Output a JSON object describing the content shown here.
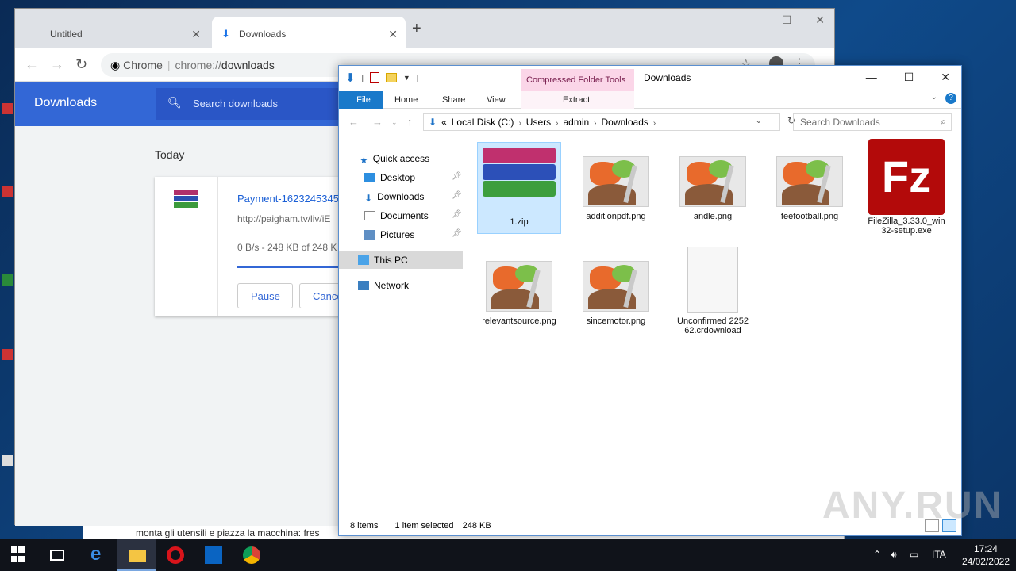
{
  "chrome": {
    "tabs": [
      {
        "label": "Untitled"
      },
      {
        "label": "Downloads"
      }
    ],
    "omnibox": {
      "security": "Chrome",
      "url_prefix": "chrome://",
      "url_path": "downloads"
    },
    "downloads_page": {
      "title": "Downloads",
      "search_placeholder": "Search downloads",
      "date_group": "Today",
      "item": {
        "filename": "Payment-1623245345-",
        "url": "http://paigham.tv/liv/iE",
        "status": "0 B/s - 248 KB of 248 K",
        "progress": 1.0,
        "pause_label": "Pause",
        "cancel_label": "Cance"
      }
    }
  },
  "explorer": {
    "contextual_tab": "Compressed Folder Tools",
    "window_title": "Downloads",
    "ribbon_tabs": {
      "file": "File",
      "home": "Home",
      "share": "Share",
      "view": "View",
      "extract": "Extract"
    },
    "address": {
      "overflow": "«",
      "crumbs": [
        "Local Disk (C:)",
        "Users",
        "admin",
        "Downloads"
      ]
    },
    "search_placeholder": "Search Downloads",
    "nav": {
      "quick_access": "Quick access",
      "desktop": "Desktop",
      "downloads": "Downloads",
      "documents": "Documents",
      "pictures": "Pictures",
      "this_pc": "This PC",
      "network": "Network"
    },
    "files": [
      {
        "name": "1.zip",
        "icon": "winrar-archive-icon"
      },
      {
        "name": "additionpdf.png",
        "icon": "paint-image-icon"
      },
      {
        "name": "andle.png",
        "icon": "paint-image-icon"
      },
      {
        "name": "feefootball.png",
        "icon": "paint-image-icon"
      },
      {
        "name": "FileZilla_3.33.0_win32-setup.exe",
        "icon": "filezilla-icon"
      },
      {
        "name": "relevantsource.png",
        "icon": "paint-image-icon"
      },
      {
        "name": "sincemotor.png",
        "icon": "paint-image-icon"
      },
      {
        "name": "Unconfirmed 225262.crdownload",
        "icon": "blank-file-icon"
      }
    ],
    "status": {
      "count": "8 items",
      "selection": "1 item selected",
      "size": "248 KB"
    }
  },
  "background_doc": {
    "text": "monta gli utensili e piazza la macchina: fres"
  },
  "watermark": "ANY.RUN",
  "taskbar": {
    "language": "ITA",
    "time": "17:24",
    "date": "24/02/2022"
  },
  "colors": {
    "chrome_blue": "#3367d6",
    "explorer_accent": "#1979ca",
    "selection": "#cce8ff",
    "contextual_tab": "#fbd6e8"
  }
}
